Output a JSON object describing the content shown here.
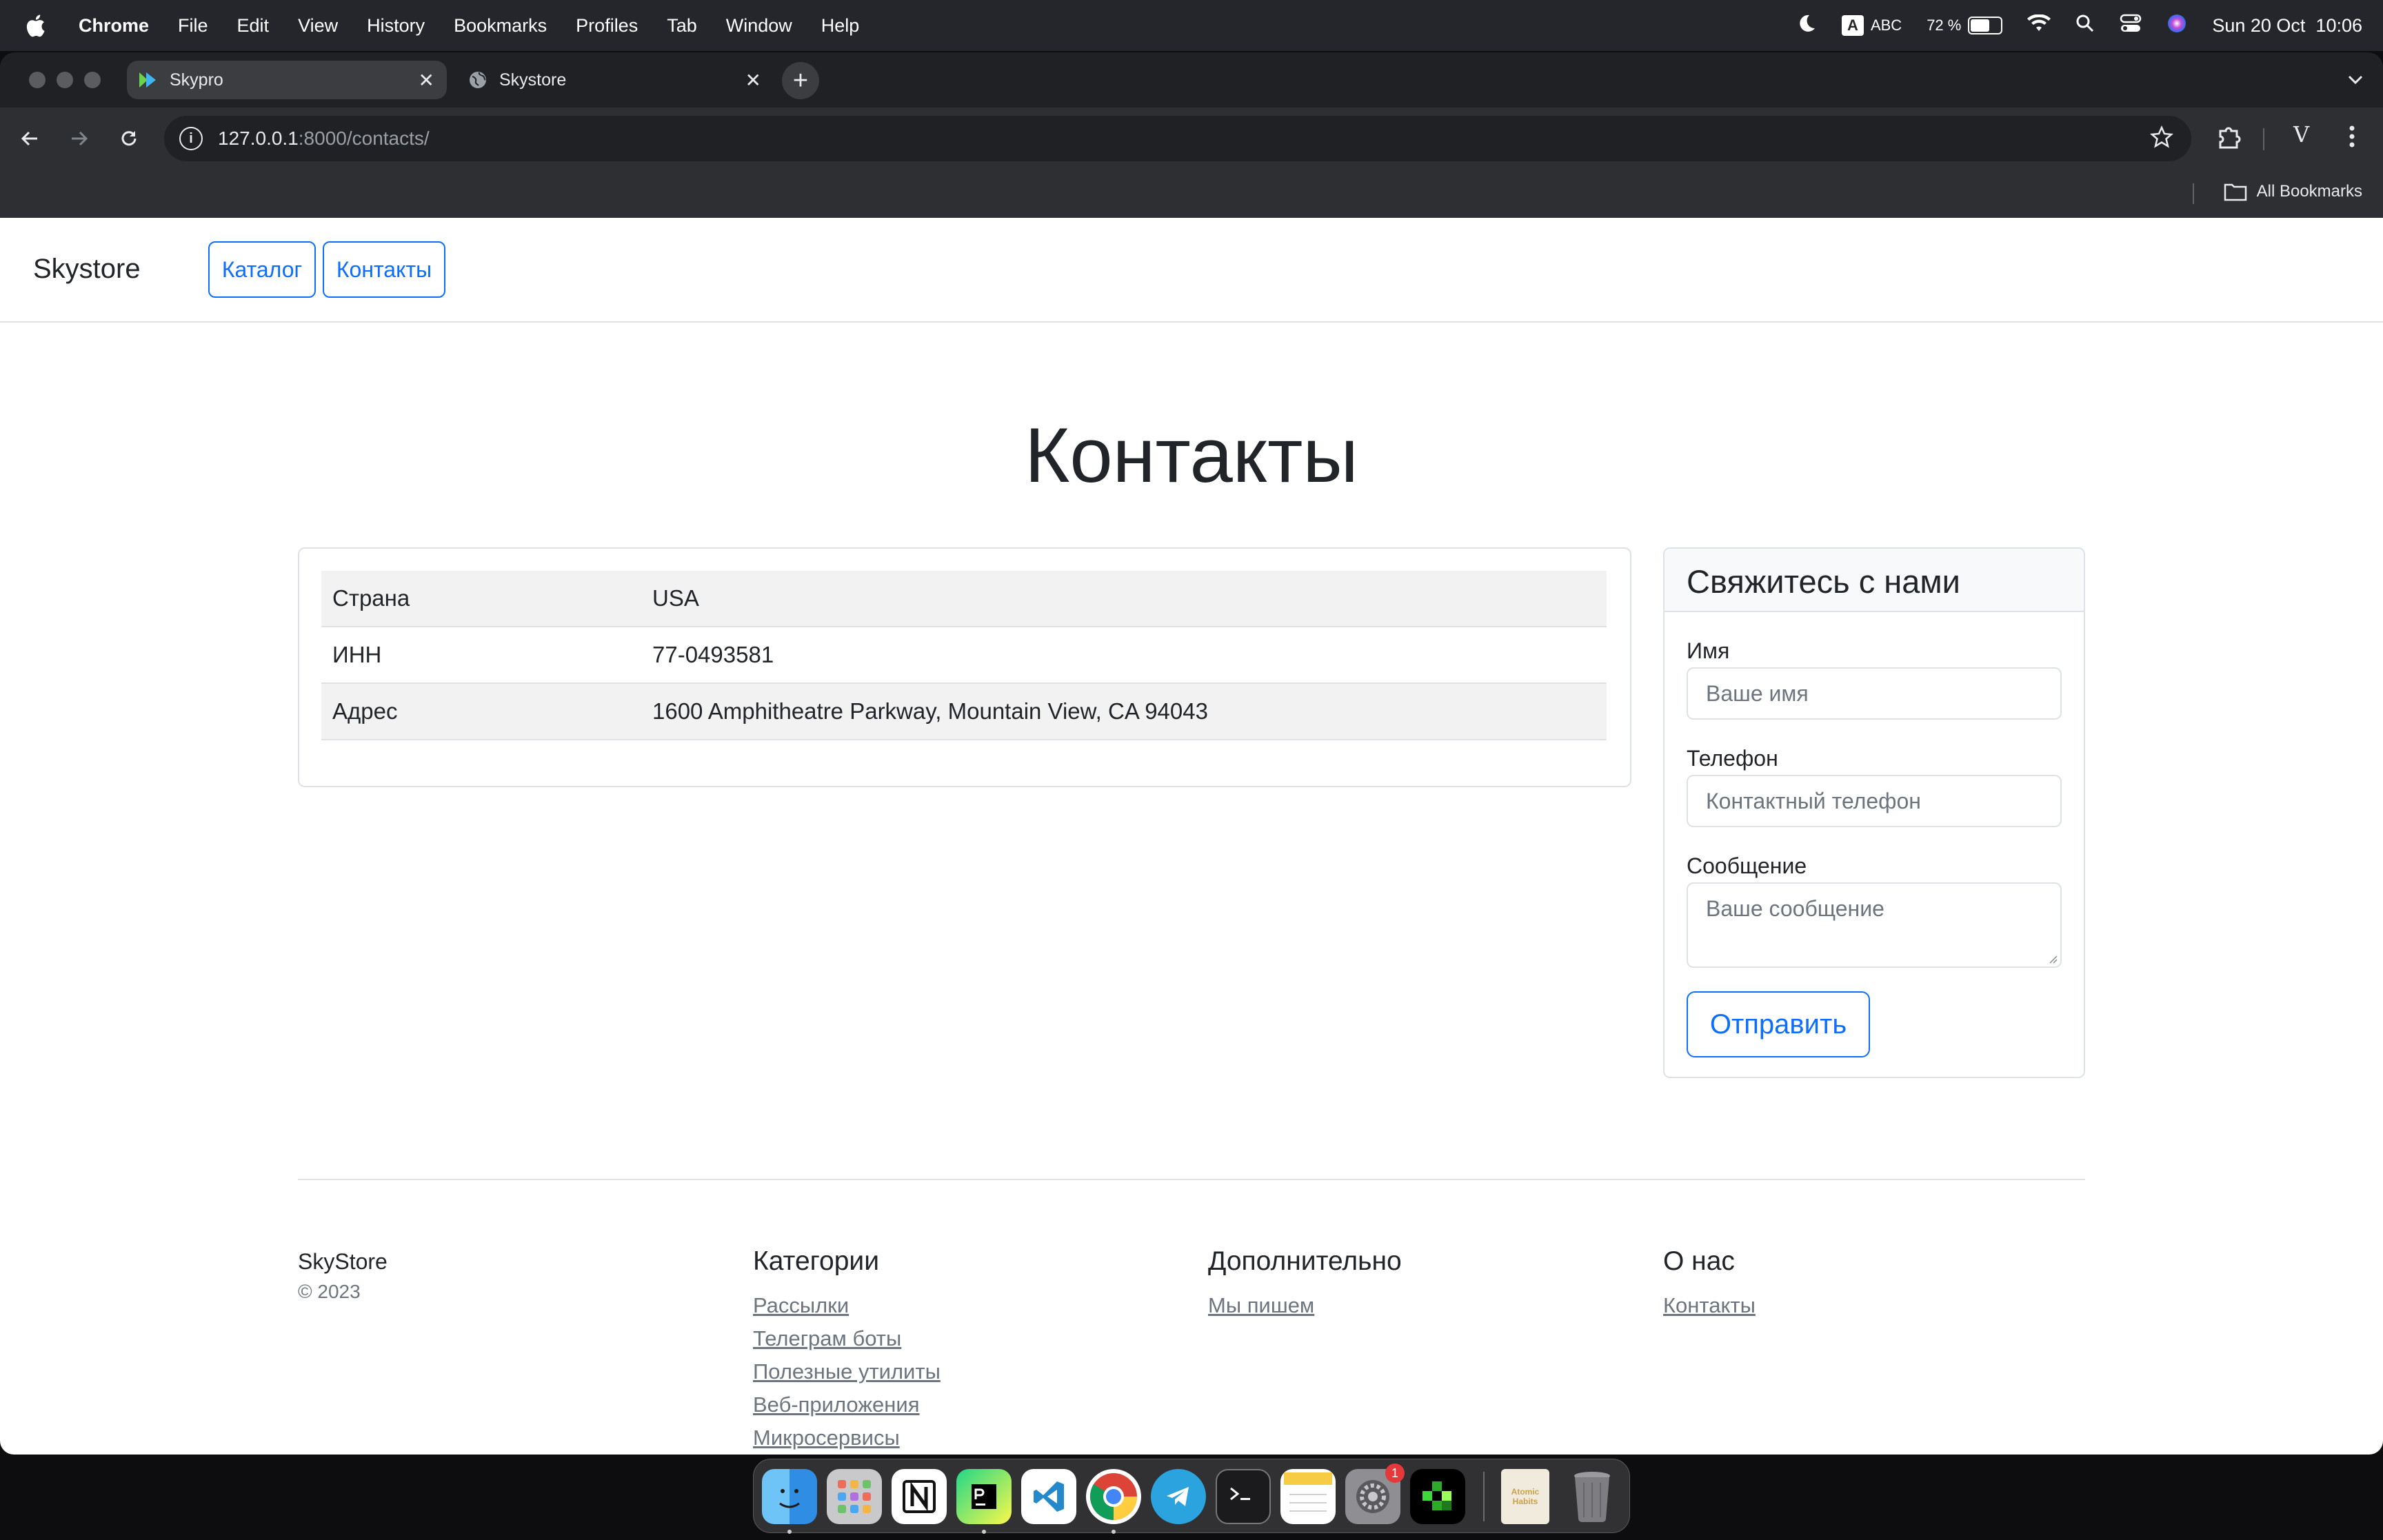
{
  "menubar": {
    "app": "Chrome",
    "items": [
      "File",
      "Edit",
      "View",
      "History",
      "Bookmarks",
      "Profiles",
      "Tab",
      "Window",
      "Help"
    ],
    "input_source": "ABC",
    "input_letter": "A",
    "battery": "72 %",
    "battery_level": 0.72,
    "datetime": "Sun 20 Oct  10:06"
  },
  "browser": {
    "tabs": [
      {
        "title": "Skypro",
        "active": true
      },
      {
        "title": "Skystore",
        "active": false
      }
    ],
    "url_host": "127.0.0.1",
    "url_rest": ":8000/contacts/",
    "profile_letter": "V",
    "all_bookmarks": "All Bookmarks"
  },
  "site": {
    "brand": "Skystore",
    "nav": [
      "Каталог",
      "Контакты"
    ],
    "title": "Контакты",
    "info": [
      {
        "key": "Страна",
        "value": "USA"
      },
      {
        "key": "ИНН",
        "value": "77-0493581"
      },
      {
        "key": "Адрес",
        "value": "1600 Amphitheatre Parkway, Mountain View, CA 94043"
      }
    ],
    "form": {
      "title": "Свяжитесь с нами",
      "name_label": "Имя",
      "name_placeholder": "Ваше имя",
      "phone_label": "Телефон",
      "phone_placeholder": "Контактный телефон",
      "message_label": "Сообщение",
      "message_placeholder": "Ваше сообщение",
      "submit": "Отправить"
    },
    "footer": {
      "brand": "SkyStore",
      "copyright": "© 2023",
      "columns": [
        {
          "title": "Категории",
          "links": [
            "Рассылки",
            "Телеграм боты",
            "Полезные утилиты",
            "Веб-приложения",
            "Микросервисы"
          ]
        },
        {
          "title": "Дополнительно",
          "links": [
            "Мы пишем"
          ]
        },
        {
          "title": "О нас",
          "links": [
            "Контакты"
          ]
        }
      ]
    }
  },
  "dock": {
    "apps": [
      "Finder",
      "Launchpad",
      "Notion",
      "PyCharm",
      "VS Code",
      "Chrome",
      "Telegram",
      "Terminal",
      "Notes",
      "System Settings",
      "Green App",
      "Atomic Habits",
      "Trash"
    ],
    "settings_badge": "1",
    "book_text": "Atomic Habits"
  }
}
